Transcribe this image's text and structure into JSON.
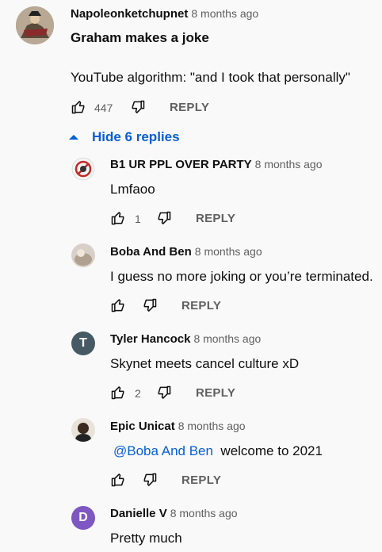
{
  "top_comment": {
    "author": "Napoleonketchupnet",
    "time": "8 months ago",
    "line1": "Graham makes a joke",
    "line2": "YouTube algorithm: \"and I took that personally\"",
    "likes": "447",
    "reply_label": "REPLY"
  },
  "replies_toggle": {
    "label": "Hide 6 replies",
    "icon": "caret-up-icon",
    "color": "#065fd4"
  },
  "replies": [
    {
      "author": "B1 UR PPL OVER PARTY",
      "time": "8 months ago",
      "text": "Lmfaoo",
      "likes": "1",
      "reply_label": "REPLY"
    },
    {
      "author": "Boba And Ben",
      "time": "8 months ago",
      "text": "I guess no more joking or you’re terminated.",
      "likes": "",
      "reply_label": "REPLY"
    },
    {
      "author": "Tyler Hancock",
      "time": "8 months ago",
      "text": "Skynet meets cancel culture xD",
      "likes": "2",
      "reply_label": "REPLY",
      "avatar_letter": "T",
      "avatar_color": "#455a64"
    },
    {
      "author": "Epic Unicat",
      "time": "8 months ago",
      "mention": "@Boba And Ben",
      "text": "welcome to 2021",
      "likes": "",
      "reply_label": "REPLY"
    },
    {
      "author": "Danielle V",
      "time": "8 months ago",
      "text": "Pretty much",
      "avatar_letter": "D",
      "avatar_color": "#7e57c2"
    }
  ]
}
